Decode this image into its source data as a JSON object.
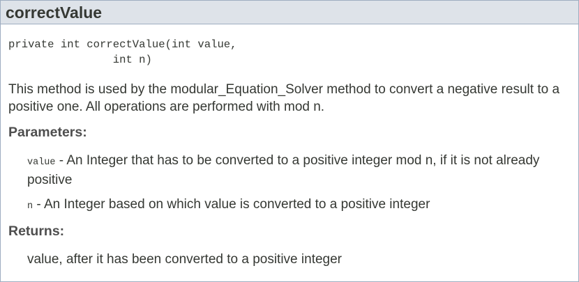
{
  "method": {
    "name": "correctValue",
    "signature": "private int correctValue(int value,\n                int n)",
    "description": "This method is used by the modular_Equation_Solver method to convert a negative result to a positive one. All operations are performed with mod n.",
    "parameters_heading": "Parameters:",
    "parameters": [
      {
        "name": "value",
        "separator": " - ",
        "description": "An Integer that has to be converted to a positive integer mod n, if it is not already positive"
      },
      {
        "name": "n",
        "separator": " - ",
        "description": "An Integer based on which value is converted to a positive integer"
      }
    ],
    "returns_heading": "Returns:",
    "returns": "value, after it has been converted to a positive integer"
  }
}
